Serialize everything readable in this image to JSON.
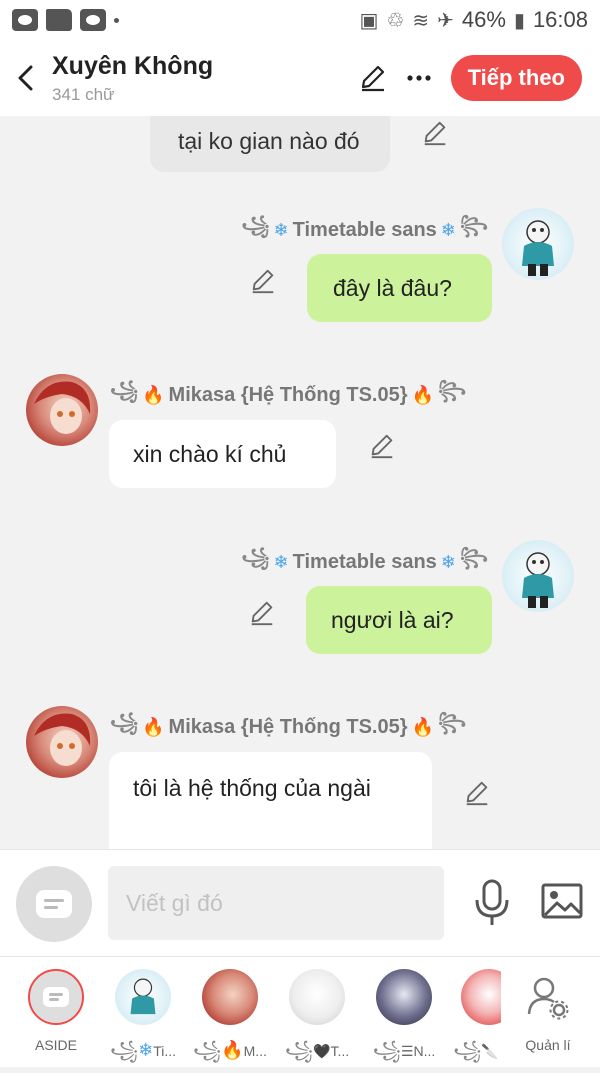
{
  "status_bar": {
    "battery": "46%",
    "time": "16:08"
  },
  "header": {
    "title": "Xuyên Không",
    "subtitle": "341 chữ",
    "next_label": "Tiếp theo"
  },
  "messages": [
    {
      "sender": "",
      "text": "tại ko gian nào đó",
      "side": "left"
    },
    {
      "sender": "Timetable sans",
      "text": "đây là đâu?",
      "side": "right"
    },
    {
      "sender": "Mikasa {Hệ Thống TS.05}",
      "text": "xin chào kí chủ",
      "side": "left"
    },
    {
      "sender": "Timetable sans",
      "text": "ngươi là ai?",
      "side": "right"
    },
    {
      "sender": "Mikasa {Hệ Thống TS.05}",
      "text": "tôi là hệ thống của ngài",
      "side": "left"
    }
  ],
  "composer": {
    "placeholder": "Viết gì đó"
  },
  "characters": [
    {
      "label": "ASIDE"
    },
    {
      "label": "Ti..."
    },
    {
      "label": "M..."
    },
    {
      "label": "T..."
    },
    {
      "label": "N..."
    },
    {
      "label": ""
    },
    {
      "label": "Quản lí"
    }
  ],
  "colors": {
    "accent": "#f04b4b",
    "bubble_green": "#cdf29c",
    "bubble_white": "#ffffff",
    "bubble_gray": "#e8e8e8"
  },
  "icons": [
    "eye-icon",
    "folder-icon",
    "back-arrow-icon",
    "pencil-icon",
    "more-icon",
    "microphone-icon",
    "image-icon",
    "manage-user-icon"
  ]
}
